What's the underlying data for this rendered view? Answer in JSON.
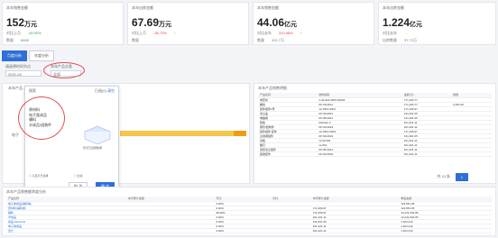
{
  "kpis": [
    {
      "title": "本年销售金额",
      "value": "152",
      "unit": "万元",
      "sub1_label": "对比上月",
      "sub1_val": "-89.99%",
      "sub2_label": "数量",
      "sub2_val": "6669"
    },
    {
      "title": "本年出库金额",
      "value": "67.69",
      "unit": "万元",
      "sub1_label": "对比上月",
      "sub1_val": "-38.73%",
      "sub2_label": "数量",
      "sub2_val": ""
    },
    {
      "title": "本年销售金额",
      "value": "44.06",
      "unit": "亿元",
      "sub1_label": "对比去年",
      "sub1_val": "220.68%",
      "sub2_label": "数量",
      "sub2_val": "191.7万"
    },
    {
      "title": "本年出库金额",
      "value": "1.224",
      "unit": "亿元",
      "sub1_label": "对比去年",
      "sub1_val": "",
      "sub2_label": "出库数量",
      "sub2_val": "37.73万"
    }
  ],
  "tabs": [
    "月度分析",
    "年度分析"
  ],
  "filters": {
    "label1": "请选择时间节点",
    "date_value": "2021-04",
    "label2": "本年产品分类",
    "class_value": "全部"
  },
  "dropdown": {
    "header_left": "已选(0)",
    "header_right": "清空",
    "header_mid": "搜索",
    "items": [
      "原材料",
      "电子类成品",
      "辅料",
      "半成品/组装件"
    ],
    "empty_text": "暂无已选择数据",
    "hint": "筛选框内容",
    "check_label": "只显示已选择",
    "check2": "全选",
    "legend": "销售金额",
    "cancel": "取 消",
    "confirm": "确 定"
  },
  "chart": {
    "section_title": "本年产品 - 类别",
    "ytick": "电子"
  },
  "right_table": {
    "title": "本年产品销售明细",
    "headers": [
      "产品名称",
      "物料编码",
      "金额(元)",
      "数量"
    ],
    "rows": [
      [
        "成套棒",
        "1-32-001-0003-00003",
        "771,106.77",
        ""
      ],
      [
        "螺纹",
        "KP-00-0011",
        "771,106.77",
        "2,461.00"
      ],
      [
        "铝件组件1号",
        "12-7810-9301",
        "171,106.97",
        ""
      ],
      [
        "法兰盖",
        "KP-99-0011",
        "131,001.05",
        ""
      ],
      [
        "电磁阀",
        "KP-88-0011",
        "131,001.05",
        ""
      ],
      [
        "垫板",
        "Flatstart 2",
        "101,421.11",
        ""
      ],
      [
        "钢管/结构件",
        "KP-00-0021",
        "101,421.11",
        ""
      ],
      [
        "铝件组件 配件",
        "12-7810-9303",
        "171,106.97",
        ""
      ],
      [
        "过滤阀组件",
        "KP-99-0021",
        "131,001.05",
        ""
      ],
      [
        "合板",
        "JJ-00-001",
        "101,421.11",
        ""
      ],
      [
        "螺钉",
        "ss-001",
        "101,421.11",
        ""
      ],
      [
        "连接法兰组件",
        "KP-85-0011",
        "101,421.11",
        ""
      ],
      [
        "其他配件",
        "KP-00-0001",
        "101,421.11",
        ""
      ]
    ],
    "pager": "共 13 条"
  },
  "bottom": {
    "title": "本年产品销售额季度分析",
    "headers": [
      "产品名称",
      "本月累计金额",
      "环比",
      "同比",
      "本年累计金额",
      "季度金额"
    ],
    "rows": [
      [
        "电子类成品(辅料等)",
        "",
        "0.00%",
        "",
        "",
        "123,551.05"
      ],
      [
        "原材料(辅料类)",
        "",
        "0.00%",
        "",
        "171,006.97",
        "123,551.05"
      ],
      [
        "辅料",
        "",
        "99.99%",
        "",
        "171,006.97",
        "12,241,003.05"
      ],
      [
        "半成品",
        "",
        "0.00%",
        "",
        "101,421.11",
        "12,241,003.05"
      ],
      [
        "成品 Electrical",
        "",
        "0.00%",
        "",
        "131,001.05",
        "1,403,210"
      ],
      [
        "电子类成品",
        "",
        "0.00%",
        "",
        "101,421.11",
        "1,403,210"
      ],
      [
        "合计",
        "",
        "0.00%",
        "",
        "101,421.11",
        "1,403,210"
      ]
    ]
  },
  "colors": {
    "accent": "#2f6fd6",
    "bar": "#f6c64a",
    "circle": "#e05050"
  }
}
